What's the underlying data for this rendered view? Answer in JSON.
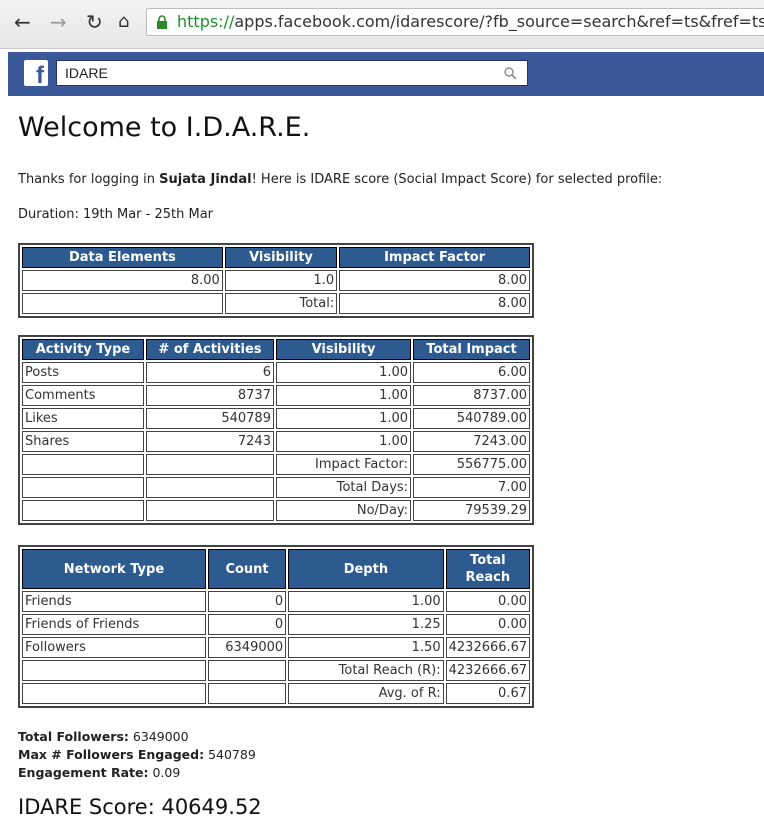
{
  "browser": {
    "back_icon": "arrow-left",
    "forward_icon": "arrow-right",
    "reload_icon": "reload",
    "home_icon": "home",
    "url_scheme": "https://",
    "url_rest": "apps.facebook.com/idarescore/?fb_source=search&ref=ts&fref=ts"
  },
  "facebook": {
    "logo": "f",
    "search_value": "IDARE",
    "brand_color": "#3b5998"
  },
  "page": {
    "title": "Welcome to I.D.A.R.E.",
    "intro_prefix": "Thanks for logging in ",
    "user_name": "Sujata Jindal",
    "intro_suffix": "! Here is IDARE score (Social Impact Score) for selected profile:",
    "duration": "Duration: 19th Mar - 25th Mar"
  },
  "impact_table": {
    "headers": [
      "Data Elements",
      "Visibility",
      "Impact Factor"
    ],
    "row": [
      "8.00",
      "1.0",
      "8.00"
    ],
    "total_label": "Total:",
    "total_value": "8.00"
  },
  "activity_table": {
    "headers": [
      "Activity Type",
      "# of Activities",
      "Visibility",
      "Total Impact"
    ],
    "rows": [
      [
        "Posts",
        "6",
        "1.00",
        "6.00"
      ],
      [
        "Comments",
        "8737",
        "1.00",
        "8737.00"
      ],
      [
        "Likes",
        "540789",
        "1.00",
        "540789.00"
      ],
      [
        "Shares",
        "7243",
        "1.00",
        "7243.00"
      ]
    ],
    "summary": [
      [
        "Impact Factor:",
        "556775.00"
      ],
      [
        "Total Days:",
        "7.00"
      ],
      [
        "No/Day:",
        "79539.29"
      ]
    ]
  },
  "network_table": {
    "headers": [
      "Network Type",
      "Count",
      "Depth",
      "Total Reach"
    ],
    "rows": [
      [
        "Friends",
        "0",
        "1.00",
        "0.00"
      ],
      [
        "Friends of Friends",
        "0",
        "1.25",
        "0.00"
      ],
      [
        "Followers",
        "6349000",
        "1.50",
        "4232666.67"
      ]
    ],
    "summary": [
      [
        "Total Reach (R):",
        "4232666.67"
      ],
      [
        "Avg. of R:",
        "0.67"
      ]
    ]
  },
  "stats": {
    "followers_label": "Total Followers:",
    "followers_value": "6349000",
    "engaged_label": "Max # Followers Engaged:",
    "engaged_value": "540789",
    "rate_label": "Engagement Rate:",
    "rate_value": "0.09"
  },
  "score": "IDARE Score: 40649.52"
}
